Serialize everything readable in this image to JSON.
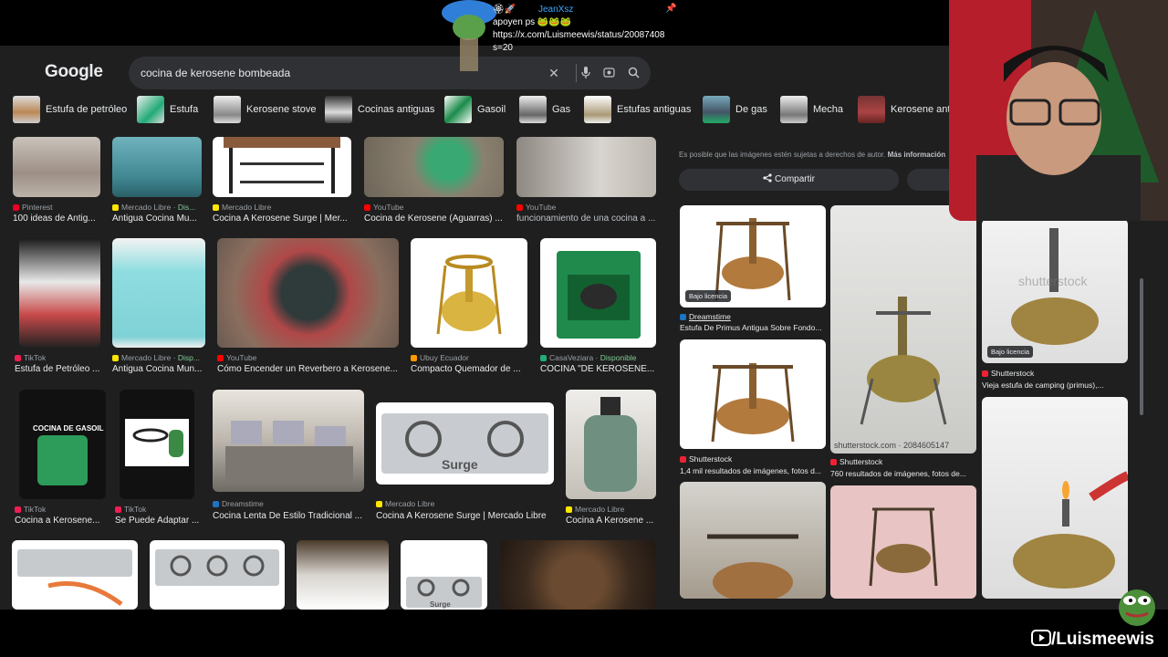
{
  "google": {
    "logo": "Google",
    "query": "cocina de kerosene bombeada",
    "chips": [
      {
        "label": "Estufa de petróleo"
      },
      {
        "label": "Estufa"
      },
      {
        "label": "Kerosene stove"
      },
      {
        "label": "Cocinas antiguas"
      },
      {
        "label": "Gasoil"
      },
      {
        "label": "Gas"
      },
      {
        "label": "Estufas antiguas"
      },
      {
        "label": "De gas"
      },
      {
        "label": "Mecha"
      },
      {
        "label": "Kerosene anti"
      }
    ]
  },
  "results": [
    {
      "source": "Pinterest",
      "avail": "",
      "title": "100 ideas de Antig..."
    },
    {
      "source": "Mercado Libre · ",
      "avail": "Dis...",
      "title": "Antigua Cocina Mu..."
    },
    {
      "source": "Mercado Libre",
      "avail": "",
      "title": "Cocina A Kerosene Surge | Mer..."
    },
    {
      "source": "YouTube",
      "avail": "",
      "title": "Cocina de Kerosene (Aguarras) ..."
    },
    {
      "source": "YouTube",
      "avail": "",
      "title": "funcionamiento de una cocina a ..."
    },
    {
      "source": "TikTok",
      "avail": "",
      "title": "Estufa de Petróleo ..."
    },
    {
      "source": "Mercado Libre · ",
      "avail": "Disp...",
      "title": "Antigua Cocina Mun..."
    },
    {
      "source": "YouTube",
      "avail": "",
      "title": "Cómo Encender un Reverbero a Kerosene..."
    },
    {
      "source": "Ubuy Ecuador",
      "avail": "",
      "title": "Compacto Quemador de ..."
    },
    {
      "source": "CasaVeziara · ",
      "avail": "Disponible",
      "title": "COCINA \"DE KEROSENE..."
    },
    {
      "source": "TikTok",
      "avail": "",
      "title": "Cocina a Kerosene..."
    },
    {
      "source": "TikTok",
      "avail": "",
      "title": "Se Puede Adaptar ..."
    },
    {
      "source": "Dreamstime",
      "avail": "",
      "title": "Cocina Lenta De Estilo Tradicional ..."
    },
    {
      "source": "Mercado Libre",
      "avail": "",
      "title": "Cocina A Kerosene Surge | Mercado Libre"
    },
    {
      "source": "Mercado Libre",
      "avail": "",
      "title": "Cocina A Kerosene ..."
    }
  ],
  "thumb_texts": {
    "gasoil_banner": "COCINA DE GASOIL",
    "surge_brand": "Surge",
    "surge_brand_small": "Surge"
  },
  "panel": {
    "notice": "Es posible que las imágenes estén sujetas a derechos de autor.",
    "notice_link": "Más información",
    "share": "Compartir",
    "license_badge": "Bajo licencia",
    "items": [
      {
        "source": "Dreamstime",
        "title": "Estufa De Primus Antigua Sobre Fondo..."
      },
      {
        "source": "Shutterstock",
        "title": "Vieja estufa de camping (primus),..."
      },
      {
        "source": "Shutterstock",
        "title": "1,4 mil resultados de imágenes, fotos d..."
      },
      {
        "source": "Shutterstock",
        "title": "760 resultados de imágenes, fotos de..."
      }
    ],
    "image_caption": "shutterstock.com · 2084605147",
    "watermark_text": "shutterstock"
  },
  "stream": {
    "chat_user": "JeanXsz",
    "chat_lines": [
      "apoyen ps 🐸🐸🐸",
      "https://x.com/Luismeewis/status/20087408",
      "s=20"
    ],
    "watermark": "/Luismeewis"
  },
  "colors": {
    "page_bg": "#1f1f1f",
    "chat_user": "#3ea6ff",
    "available": "#81c995"
  }
}
